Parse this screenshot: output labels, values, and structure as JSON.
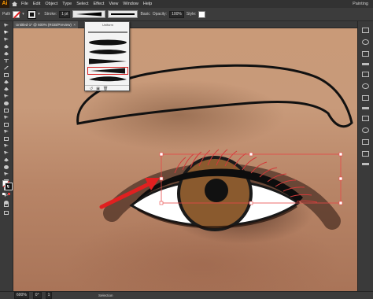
{
  "app": {
    "logo": "Ai",
    "menu": [
      "File",
      "Edit",
      "Object",
      "Type",
      "Select",
      "Effect",
      "View",
      "Window",
      "Help"
    ],
    "workspace": "Painting"
  },
  "control_bar": {
    "path_label": "Path",
    "stroke_label": "Stroke:",
    "stroke_value": "1 pt",
    "brush_label": "Basic",
    "opacity_label": "Opacity:",
    "opacity_value": "100%",
    "style_label": "Style:"
  },
  "document": {
    "tab_title": "Untitled-1* @ 600% (RGB/Preview)",
    "close_symbol": "×"
  },
  "profile_menu": {
    "header_label": "Uniform",
    "options": [
      "uniform",
      "profile-2",
      "profile-3",
      "profile-4",
      "profile-5",
      "profile-6"
    ],
    "selected_index": 4
  },
  "status_bar": {
    "zoom": "600%",
    "angle": "0°",
    "artboard": "1",
    "tool_name": "Selection"
  },
  "colors": {
    "accent_red": "#e02020",
    "selection_outline": "#e84646",
    "iris": "#8a5a2e",
    "app_chrome": "#535353"
  }
}
